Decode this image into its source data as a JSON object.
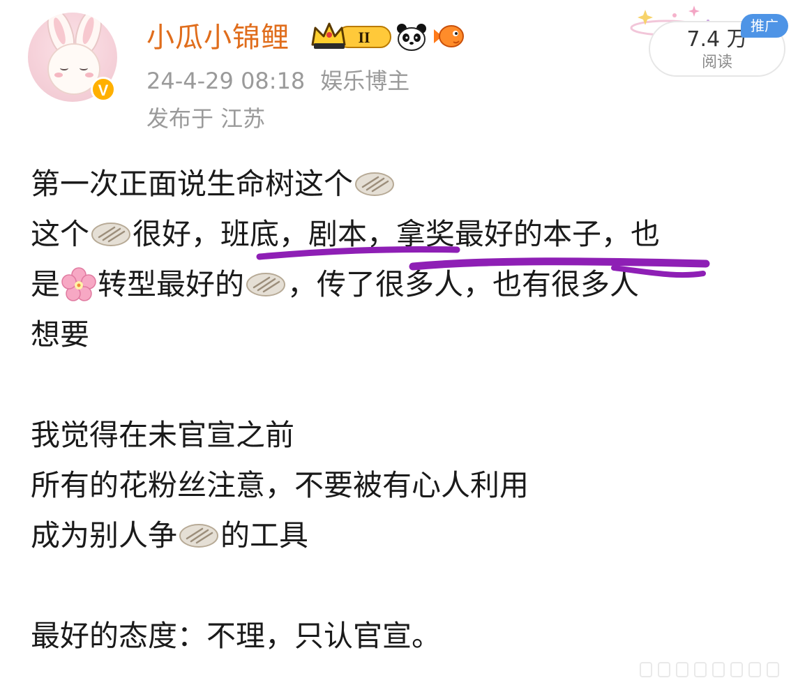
{
  "post": {
    "author": {
      "name": "小瓜小锦鲤",
      "verified_badge": "V",
      "level_badge": "II",
      "icons": [
        "crown-icon",
        "panda-icon",
        "fish-icon"
      ]
    },
    "timestamp": "24-4-29 08:18",
    "role": "娱乐博主",
    "location": "发布于 江苏",
    "read": {
      "count": "7.4 万",
      "label": "阅读"
    },
    "promo_tag": "推广"
  },
  "content": {
    "line1": {
      "a": "第一次正面说生命树这个"
    },
    "line2": {
      "a": "这个",
      "b": "很好，班底，剧本，拿奖最好的本子，也"
    },
    "line3": {
      "a": "是",
      "b": "转型最好的",
      "c": "，传了很多人，也有很多人"
    },
    "line4": {
      "a": "想要"
    },
    "line5": {
      "a": "我觉得在未官宣之前"
    },
    "line6": {
      "a": "所有的花粉丝注意，不要被有心人利用"
    },
    "line7": {
      "a": "成为别人争",
      "b": "的工具"
    },
    "line8": {
      "a": "最好的态度：不理，只认官宣。"
    }
  },
  "colors": {
    "username": "#e06d1c",
    "meta": "#9a9a9a",
    "marker": "#8e1fb5",
    "promo": "#4e94e6",
    "verified": "#ffb000"
  }
}
